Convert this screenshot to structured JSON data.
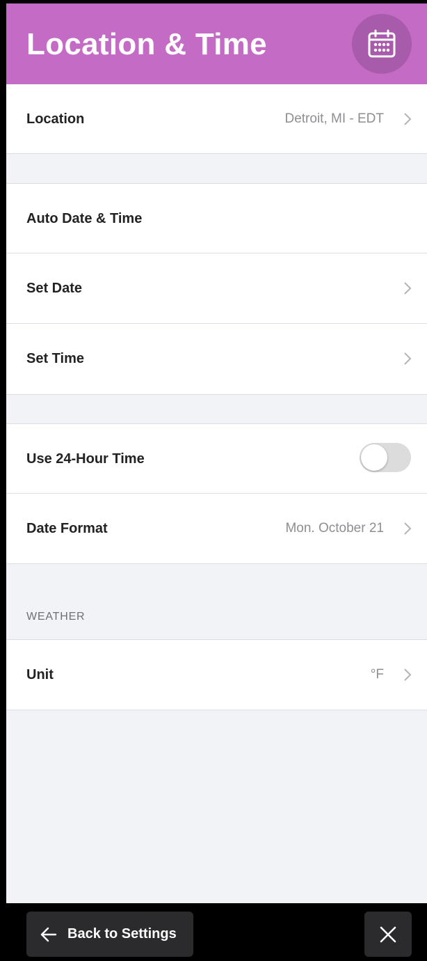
{
  "header": {
    "title": "Location & Time",
    "icon": "calendar-icon",
    "color": "#c36bc5"
  },
  "rows": {
    "location": {
      "label": "Location",
      "value": "Detroit, MI  - EDT"
    },
    "auto_date_time": {
      "label": "Auto Date & Time"
    },
    "set_date": {
      "label": "Set Date"
    },
    "set_time": {
      "label": "Set Time"
    },
    "use_24_hour": {
      "label": "Use 24-Hour Time",
      "toggle_on": false
    },
    "date_format": {
      "label": "Date Format",
      "value": "Mon. October 21"
    }
  },
  "weather": {
    "section_label": "WEATHER",
    "unit": {
      "label": "Unit",
      "value": "°F"
    }
  },
  "footer": {
    "back_label": "Back to Settings",
    "back_icon": "arrow-left-icon",
    "close_icon": "close-icon"
  }
}
